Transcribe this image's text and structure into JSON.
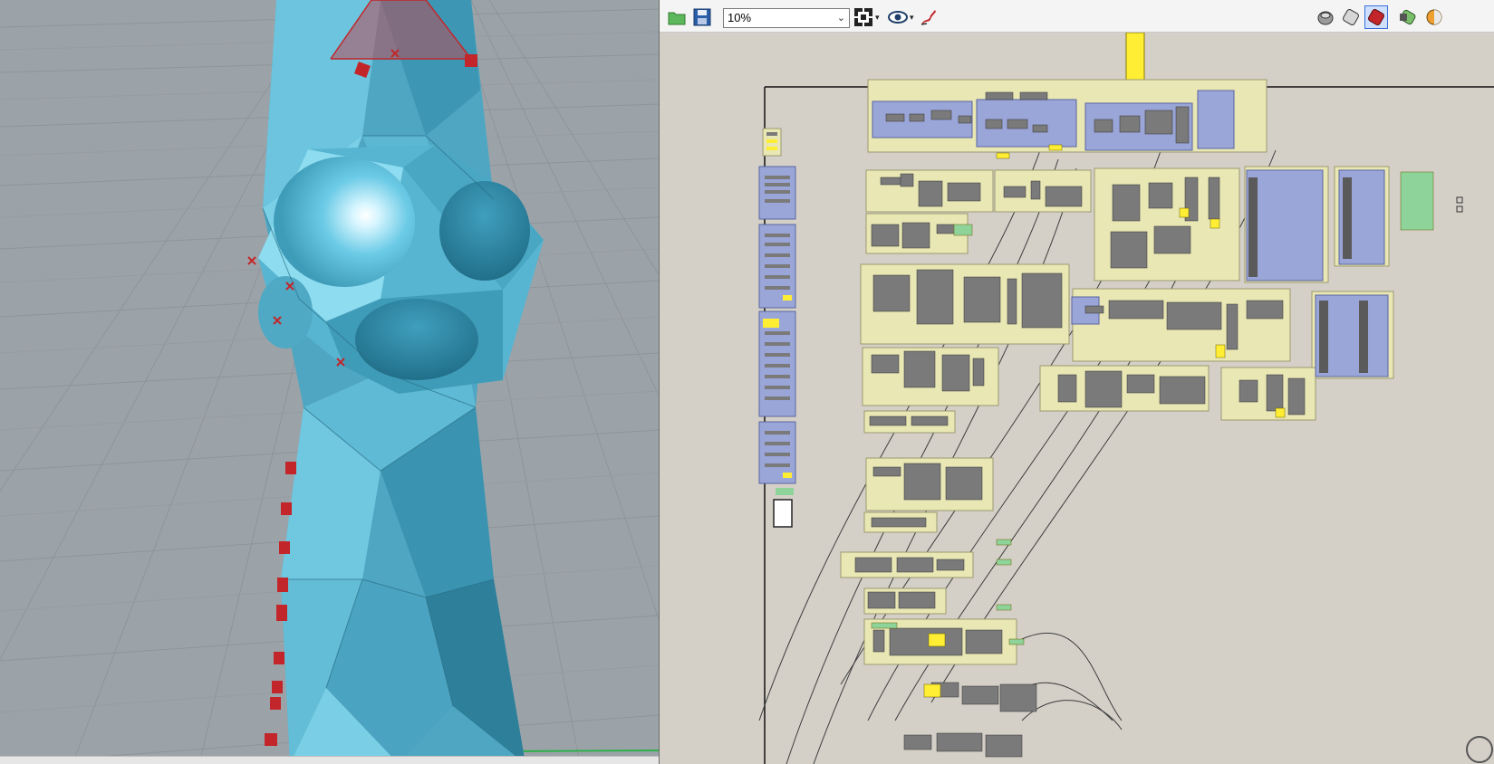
{
  "viewport": {
    "colors": {
      "background": "#9ca3a8",
      "grid": "#8d949a",
      "model": "#4fa7c3",
      "model_light": "#7fd2ea",
      "model_dark": "#2a7088",
      "points": "#c2262a"
    }
  },
  "grasshopper": {
    "toolbar": {
      "open_icon": "open-file-icon",
      "save_icon": "save-file-icon",
      "zoom_value": "10%",
      "zoom_chevron": "⌄",
      "zoom_extents_icon": "zoom-extents-icon",
      "preview_icon": "eye-icon",
      "sketch_icon": "sketch-pen-icon",
      "preview_wire_icon": "wireframe-preview-icon",
      "preview_shaded_icon": "shaded-preview-icon",
      "preview_selected_icon": "selected-preview-icon",
      "preview_mesh_icon": "mesh-quality-icon",
      "color_icon": "color-sphere-icon",
      "caret": "▾"
    },
    "colors": {
      "canvas": "#d4d0c8",
      "group_yellow": "#e9e7b4",
      "group_blue": "#9aa5d8",
      "component": "#7a7a7a",
      "param_yellow": "#ffee33",
      "param_green": "#8ed49a",
      "wire": "#444444"
    }
  }
}
